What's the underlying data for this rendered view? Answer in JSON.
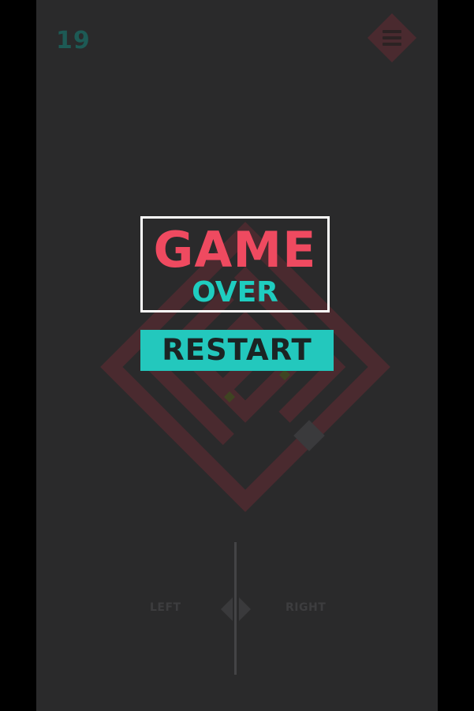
{
  "hud": {
    "score": "19",
    "menu_icon": "hamburger-menu-icon"
  },
  "game_over": {
    "title": "GAME",
    "subtitle": "OVER",
    "restart_label": "RESTART"
  },
  "controls": {
    "left_label": "LEFT",
    "right_label": "RIGHT",
    "arrows_icon": "left-right-arrows-icon"
  },
  "colors": {
    "background": "#2a2a2b",
    "score": "#1d5a55",
    "title": "#ef4a60",
    "subtitle": "#1fcdc0",
    "restart_bg": "#23c8bd",
    "maze": "#4a2a2f"
  }
}
